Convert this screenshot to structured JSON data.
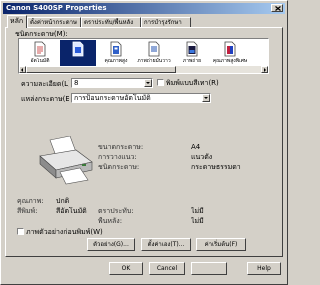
{
  "window": {
    "title": "Canon S400SP Properties"
  },
  "colors": {
    "face": "#d4d0c8",
    "title_start": "#0a246a",
    "title_end": "#a6caf0",
    "selection": "#0a246a"
  },
  "tabs": [
    {
      "label": "หลัก",
      "selected": true
    },
    {
      "label": "ตั้งค่าหน้ากระดาษ"
    },
    {
      "label": "ตราประทับ/พื้นหลัง"
    },
    {
      "label": "การบำรุงรักษา"
    }
  ],
  "media": {
    "label": "ชนิดกระดาษ(M):",
    "selected_index": 1,
    "items": [
      {
        "label": "อัตโนมัติ",
        "icon": "plain-paper-icon"
      },
      {
        "label": "",
        "icon": "photo-paper-icon"
      },
      {
        "label": "คุณภาพสูง",
        "icon": "high-resolution-paper-icon"
      },
      {
        "label": "ภาพถ่ายมันวาว",
        "icon": "glossy-paper-icon"
      },
      {
        "label": "ภาพถ่าย",
        "icon": "photo-card-icon"
      },
      {
        "label": "คุณภาพสูงพิเศษ",
        "icon": "super-high-quality-paper-icon"
      }
    ]
  },
  "quality": {
    "label": "ความละเอียด(L):",
    "value": "8",
    "grayscale_label": "พิมพ์แบบสีเทา(R)",
    "grayscale_checked": false
  },
  "source": {
    "label": "แหล่งกระดาษ(E):",
    "value": "การป้อนกระดาษอัตโนมัติ"
  },
  "summary": {
    "paper_size": {
      "label": "ขนาดกระดาษ:",
      "value": "A4"
    },
    "orientation": {
      "label": "การวางแนว:",
      "value": "แนวตั้ง"
    },
    "media_type": {
      "label": "ชนิดกระดาษ:",
      "value": "กระดาษธรรมดา"
    },
    "print_quality": {
      "label": "คุณภาพ:",
      "value": "ปกติ"
    },
    "color": {
      "label": "สีพิมพ์:",
      "value": "สีอัตโนมัติ"
    },
    "stamp": {
      "label": "ตราประทับ:",
      "value": "ไม่มี"
    },
    "background": {
      "label": "พื้นหลัง:",
      "value": "ไม่มี"
    }
  },
  "preview": {
    "label": "ภาพตัวอย่างก่อนพิมพ์(W)",
    "checked": false
  },
  "actions": {
    "preview_label": "ตัวอย่าง(G)...",
    "custom_label": "ตั้งค่าเอง(T)...",
    "defaults_label": "ค่าเริ่มต้น(F)"
  },
  "dialog": {
    "ok": "OK",
    "cancel": "Cancel",
    "help": "Help"
  }
}
